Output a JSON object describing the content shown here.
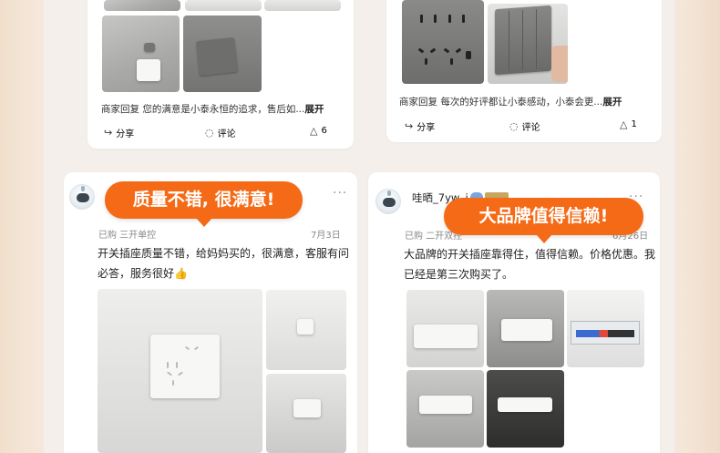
{
  "top_left": {
    "reply_text": "商家回复 您的满意是小泰永恒的追求，售后如...",
    "reply_more": "展开",
    "share_label": "分享",
    "comment_label": "评论",
    "like_count": "6"
  },
  "top_right": {
    "reply_text": "商家回复 每次的好评都让小泰感动，小泰会更...",
    "reply_more": "展开",
    "share_label": "分享",
    "comment_label": "评论",
    "like_count": "1"
  },
  "review_left": {
    "bubble": "质量不错, 很满意!",
    "purchased": "已购  三开单控",
    "date": "7月3日",
    "text": "开关插座质量不错，给妈妈买的，很满意，客服有问必答，服务很好👍"
  },
  "review_right": {
    "bubble": "大品牌值得信赖!",
    "username": "哇晒_7yw..i",
    "purchased": "已购  二开双控",
    "date": "6月26日",
    "text": "大品牌的开关插座靠得住，值得信赖。价格优惠。我已经是第三次购买了。"
  },
  "icons": {
    "share": "share-icon",
    "comment": "comment-icon",
    "like": "thumbs-up-icon",
    "more": "more-dots-icon"
  }
}
